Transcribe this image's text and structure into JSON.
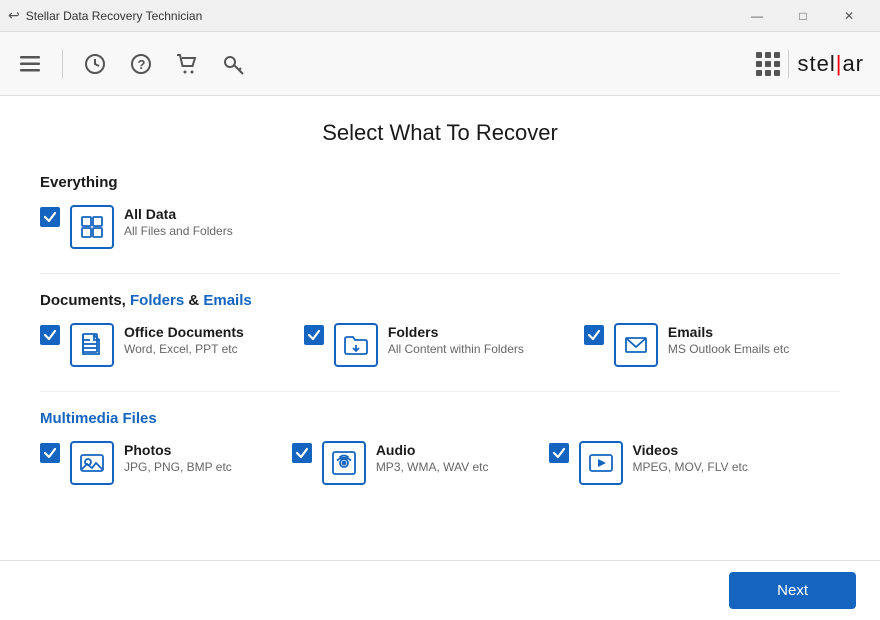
{
  "titlebar": {
    "title": "Stellar Data Recovery Technician",
    "minimize_label": "—",
    "maximize_label": "□",
    "close_label": "✕"
  },
  "toolbar": {
    "icons": [
      {
        "name": "menu-icon",
        "symbol": "☰"
      },
      {
        "name": "history-icon",
        "symbol": "⏱"
      },
      {
        "name": "help-icon",
        "symbol": "?"
      },
      {
        "name": "cart-icon",
        "symbol": "🛒"
      },
      {
        "name": "key-icon",
        "symbol": "🔑"
      }
    ],
    "logo_text_pre": "stel",
    "logo_text_cursor": "|",
    "logo_text_post": "ar"
  },
  "page": {
    "title": "Select What To Recover"
  },
  "sections": [
    {
      "id": "everything",
      "title": "Everything",
      "title_blue": false,
      "items": [
        {
          "id": "all-data",
          "checked": true,
          "icon": "all-data-icon",
          "name": "All Data",
          "desc": "All Files and Folders"
        }
      ]
    },
    {
      "id": "documents",
      "title_parts": [
        {
          "text": "Documents, ",
          "blue": false
        },
        {
          "text": "Folders",
          "blue": true
        },
        {
          "text": " & ",
          "blue": false
        },
        {
          "text": "Emails",
          "blue": true
        }
      ],
      "items": [
        {
          "id": "office-documents",
          "checked": true,
          "icon": "office-documents-icon",
          "name": "Office Documents",
          "desc": "Word, Excel, PPT etc"
        },
        {
          "id": "folders",
          "checked": true,
          "icon": "folders-icon",
          "name": "Folders",
          "desc": "All Content within Folders"
        },
        {
          "id": "emails",
          "checked": true,
          "icon": "emails-icon",
          "name": "Emails",
          "desc": "MS Outlook Emails etc"
        }
      ]
    },
    {
      "id": "multimedia",
      "title": "Multimedia Files",
      "title_blue": true,
      "items": [
        {
          "id": "photos",
          "checked": true,
          "icon": "photos-icon",
          "name": "Photos",
          "desc": "JPG, PNG, BMP etc"
        },
        {
          "id": "audio",
          "checked": true,
          "icon": "audio-icon",
          "name": "Audio",
          "desc": "MP3, WMA, WAV etc"
        },
        {
          "id": "videos",
          "checked": true,
          "icon": "videos-icon",
          "name": "Videos",
          "desc": "MPEG, MOV, FLV etc"
        }
      ]
    }
  ],
  "footer": {
    "next_label": "Next"
  }
}
